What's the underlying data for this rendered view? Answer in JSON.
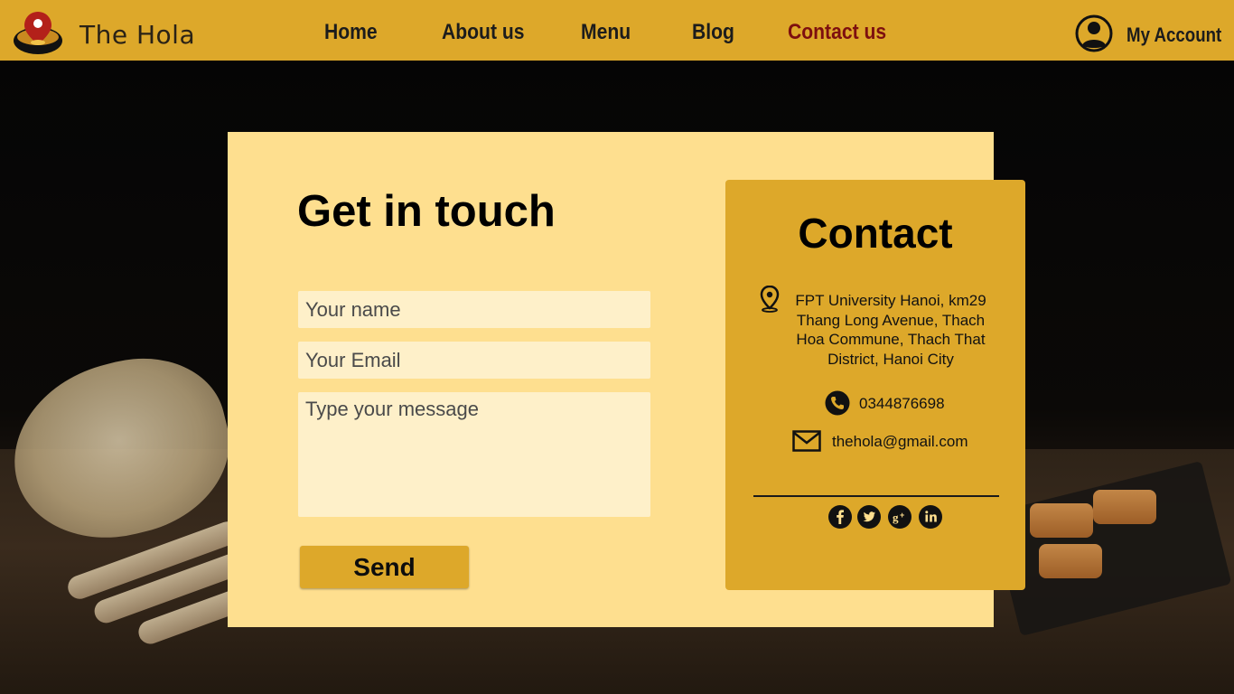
{
  "header": {
    "brand": "The Hola",
    "nav": [
      {
        "label": "Home"
      },
      {
        "label": "About us"
      },
      {
        "label": "Menu"
      },
      {
        "label": "Blog"
      },
      {
        "label": "Contact us",
        "active": true
      }
    ],
    "account_label": "My Account",
    "logo_icon": "bowl-pin-logo-icon",
    "account_icon": "user-circle-icon"
  },
  "form": {
    "title": "Get in touch",
    "name_placeholder": "Your name",
    "email_placeholder": "Your Email",
    "message_placeholder": "Type your message",
    "send_label": "Send"
  },
  "contact": {
    "title": "Contact",
    "address": "FPT University Hanoi, km29 Thang Long Avenue, Thach Hoa Commune, Thach That District, Hanoi City",
    "phone": "0344876698",
    "email": "thehola@gmail.com",
    "social": [
      "facebook-icon",
      "twitter-icon",
      "google-plus-icon",
      "linkedin-icon"
    ]
  },
  "colors": {
    "header": "#dda82a",
    "card": "#fedf8f",
    "input": "#fef0c9",
    "active_nav": "#7d0f0f",
    "button": "#dda82a"
  }
}
